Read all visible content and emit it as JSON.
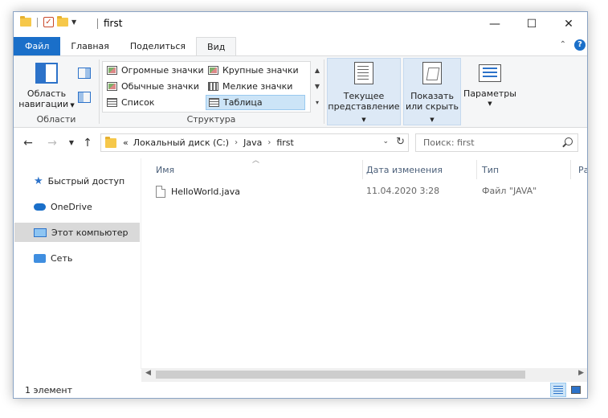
{
  "window": {
    "title": "first",
    "controls": {
      "minimize": "—",
      "maximize": "☐",
      "close": "✕"
    }
  },
  "ribbon_tabs": [
    {
      "label": "Файл"
    },
    {
      "label": "Главная"
    },
    {
      "label": "Поделиться"
    },
    {
      "label": "Вид"
    }
  ],
  "ribbon": {
    "panes_group": {
      "nav_pane_label": "Область навигации",
      "group_label": "Области"
    },
    "layout_group": {
      "items": [
        {
          "label": "Огромные значки"
        },
        {
          "label": "Крупные значки"
        },
        {
          "label": "Обычные значки"
        },
        {
          "label": "Мелкие значки"
        },
        {
          "label": "Список"
        },
        {
          "label": "Таблица",
          "selected": true
        }
      ],
      "group_label": "Структура"
    },
    "current_view_label": "Текущее представление",
    "show_hide_label": "Показать или скрыть",
    "options_label": "Параметры"
  },
  "address_bar": {
    "overflow": "«",
    "crumbs": [
      "Локальный диск (C:)",
      "Java",
      "first"
    ],
    "search_placeholder": "Поиск: first"
  },
  "nav_pane": {
    "items": [
      {
        "label": "Быстрый доступ",
        "icon": "star-icon"
      },
      {
        "label": "OneDrive",
        "icon": "cloud-icon"
      },
      {
        "label": "Этот компьютер",
        "icon": "computer-icon",
        "selected": true
      },
      {
        "label": "Сеть",
        "icon": "network-icon"
      }
    ]
  },
  "file_list": {
    "columns": [
      "Имя",
      "Дата изменения",
      "Тип",
      "Ра"
    ],
    "rows": [
      {
        "name": "HelloWorld.java",
        "modified": "11.04.2020 3:28",
        "type": "Файл \"JAVA\""
      }
    ]
  },
  "status_bar": {
    "item_count": "1 элемент"
  },
  "colors": {
    "accent": "#1a6fc9",
    "selection": "#cce4f7",
    "folder": "#f6c84a"
  }
}
